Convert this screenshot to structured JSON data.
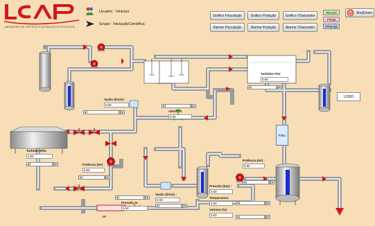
{
  "header": {
    "logo_text": "LCAP",
    "logo_subtitle": "LABORATÓRIO DE CONTROLE E AUTOMAÇÃO DE PROCESSOS",
    "user_label": "Usuário : Vinicius",
    "group_label": "Grupo : IniciaçãoCientífica"
  },
  "buttons": {
    "grafico_floculacao": "Gráfico Floculação",
    "grafico_flotacao": "Gráfico Flotação",
    "grafico_vsaturador": "Gráfico VSaturador",
    "alarme_floculacao": "Alarme Floculação",
    "alarme_flotacao": "Alarme Flotação",
    "alarme_vsaturador": "Alarme VSaturador",
    "reciclo": "Reciclo",
    "ptotal": "PTotal",
    "pparcial": "PParcial",
    "shutdown": "ShutDown"
  },
  "colors": {
    "background": "#f7deb6",
    "reciclo": "#c2e9b3",
    "ptotal": "#f6c5d2",
    "pparcial": "#b9c9f2",
    "pipe": "#cfcfcf",
    "accent_red": "#d11919"
  },
  "labels": {
    "vazao1": "Vazão (l/min) :",
    "abertura": "Abertura",
    "turbidez_flot": "Turbidez Flot",
    "turbidez_efl": "Turbidez Eflu",
    "potencia1": "Potência (Hz) :",
    "potencia2": "Potência (Hz) :",
    "vazao2": "Vazão (l/min) :",
    "pressao_ar": "Pressão Ar",
    "pressao_bar": "Pressão (bar) :",
    "temperatura": "Temperatura",
    "volume": "Volume (%):",
    "ar": "AR",
    "lodo": "LODO",
    "filtro": "Filtro"
  },
  "values": {
    "vazao1": "0.00",
    "abertura": "0.00",
    "turbidez_flot": "0.00",
    "turbidez_efl": "0.00",
    "potencia1": "0.00",
    "potencia2": "0.00",
    "vazao2": "0.00",
    "pressao_ar": "0.00",
    "pressao_bar": "0.00",
    "temperatura": "0.00",
    "volume": "0.00"
  },
  "slider_arrows": {
    "left": "◂",
    "right": "▸"
  }
}
